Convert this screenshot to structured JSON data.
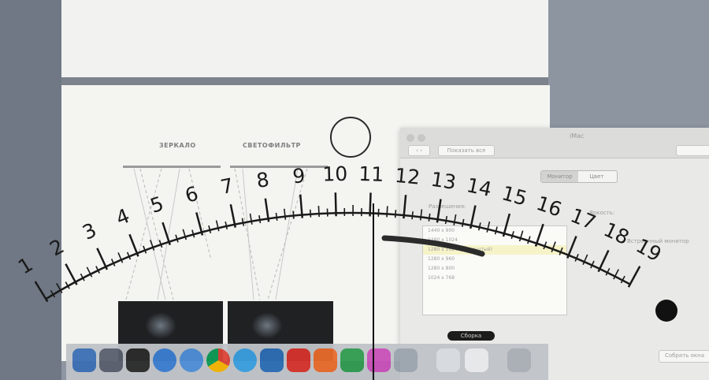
{
  "diagram": {
    "label_left": "ЗЕРКАЛО",
    "label_right": "СВЕТОФИЛЬТР"
  },
  "prefs_window": {
    "title": "iMac",
    "toolbar_button": "Показать все",
    "segments": [
      "Монитор",
      "Цвет"
    ],
    "resolution_label": "Разрешения:",
    "resolutions": [
      "1440 x 900",
      "1280 x 1024",
      "1280 x 1024 (растянутый)",
      "1280 x 960",
      "1280 x 800",
      "1024 x 768"
    ],
    "selected_index": 2,
    "brightness_label": "Яркость:",
    "right_option": "Встроенный монитор",
    "bottom_button": "Собрать окна",
    "detect_label": "Сборка"
  },
  "dial": {
    "ticks": [
      "1",
      "2",
      "3",
      "4",
      "5",
      "6",
      "7",
      "8",
      "9",
      "10",
      "11",
      "12",
      "13",
      "14",
      "15",
      "16",
      "17",
      "18",
      "19"
    ],
    "pointer_value": 11.1
  },
  "dock": {
    "icons": [
      "finder-icon",
      "launchpad-icon",
      "terminal-icon",
      "app-store-icon",
      "safari-icon",
      "chrome-icon",
      "itunes-icon",
      "word-icon",
      "pdf-icon",
      "pages-icon",
      "excel-icon",
      "yandex-icon",
      "preview-icon",
      "folder-icon",
      "doc-icon",
      "trash-icon"
    ]
  },
  "colors": {
    "screen": "#f4f4f1",
    "bezel": "#6f7884",
    "dial_ink": "#1a1a1a",
    "needle_band": "#2b2b2b"
  }
}
